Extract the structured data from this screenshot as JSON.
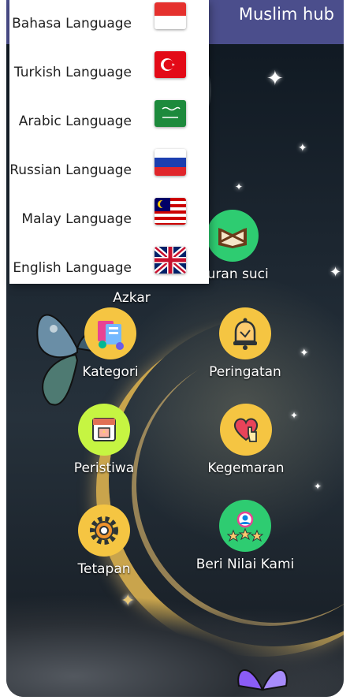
{
  "appbar": {
    "title": "Muslim hub"
  },
  "language_menu": {
    "items": [
      {
        "label": "Bahasa Language",
        "flag": "indonesia-flag"
      },
      {
        "label": "Turkish Language",
        "flag": "turkey-flag"
      },
      {
        "label": "Arabic Language",
        "flag": "saudi-arabia-flag"
      },
      {
        "label": "Russian Language",
        "flag": "russia-flag"
      },
      {
        "label": "Malay Language",
        "flag": "malaysia-flag"
      },
      {
        "label": "English Language",
        "flag": "uk-flag"
      }
    ]
  },
  "menu": {
    "items": [
      {
        "label": "Azkar",
        "icon": "book-icon",
        "color": "#f5c542"
      },
      {
        "label": "Quran suci",
        "icon": "quran-icon",
        "color": "#2ecc71"
      },
      {
        "label": "Kategori",
        "icon": "categories-icon",
        "color": "#f5c542"
      },
      {
        "label": "Peringatan",
        "icon": "bell-icon",
        "color": "#f5c542"
      },
      {
        "label": "Peristiwa",
        "icon": "calendar-icon",
        "color": "#c6f542"
      },
      {
        "label": "Kegemaran",
        "icon": "heart-hand-icon",
        "color": "#f5c542"
      },
      {
        "label": "Tetapan",
        "icon": "gear-icon",
        "color": "#f5c542"
      },
      {
        "label": "Beri Nilai Kami",
        "icon": "rating-stars-icon",
        "color": "#2ecc71"
      }
    ]
  }
}
